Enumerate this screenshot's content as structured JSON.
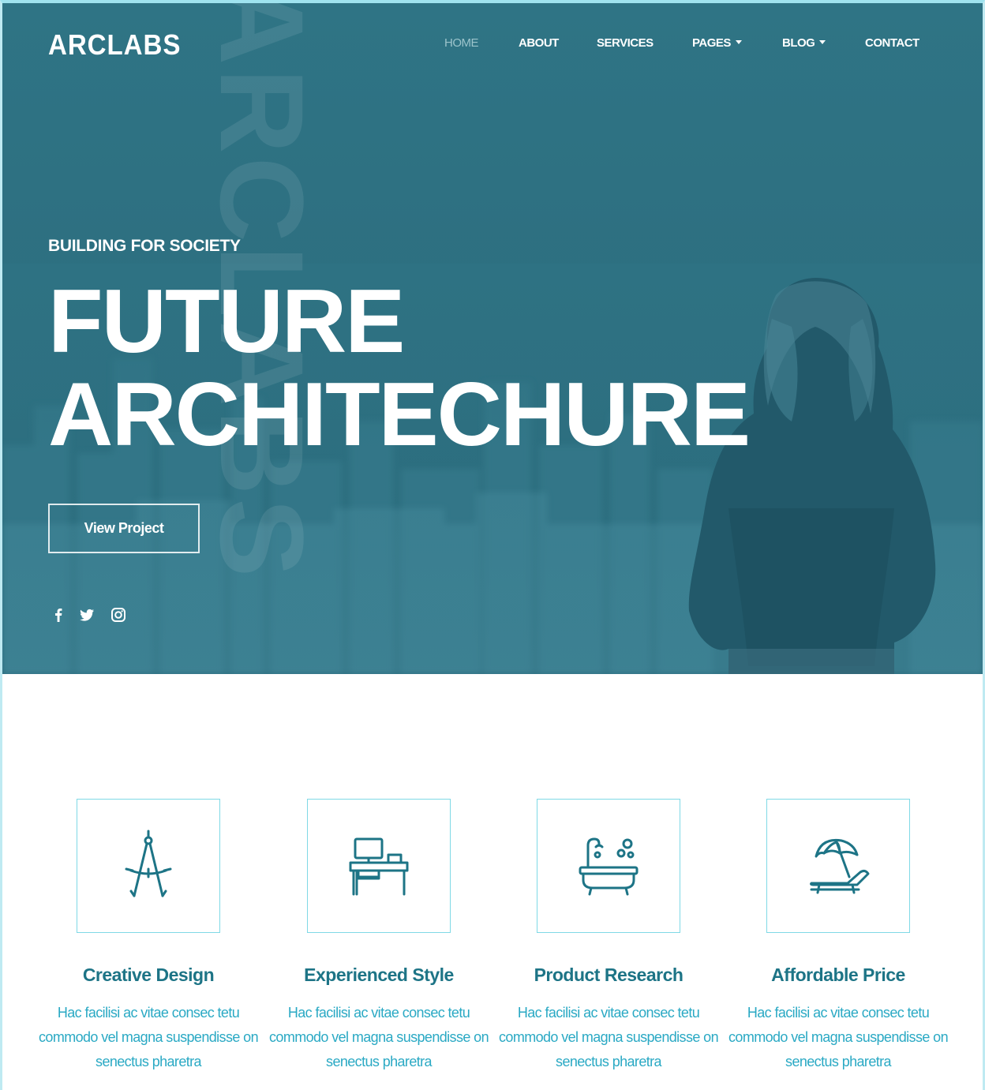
{
  "brand": {
    "logo": "ARCLABS",
    "watermark": "ARCLABS"
  },
  "nav": {
    "items": [
      {
        "label": "HOME",
        "active": true
      },
      {
        "label": "ABOUT"
      },
      {
        "label": "SERVICES"
      },
      {
        "label": "PAGES",
        "dropdown": true
      },
      {
        "label": "BLOG",
        "dropdown": true
      },
      {
        "label": "CONTACT"
      }
    ]
  },
  "hero": {
    "eyebrow": "BUILDING FOR SOCIETY",
    "headline_line1": "FUTURE",
    "headline_line2": "ARCHITECHURE",
    "cta_label": "View Project",
    "social": [
      "facebook-icon",
      "twitter-icon",
      "instagram-icon"
    ],
    "overlay_color": "#2d7081"
  },
  "features": [
    {
      "icon": "compass-icon",
      "title": "Creative Design",
      "text": "Hac facilisi ac vitae consec tetu commodo vel magna suspendisse on senectus pharetra"
    },
    {
      "icon": "desk-computer-icon",
      "title": "Experienced Style",
      "text": "Hac facilisi ac vitae consec tetu commodo vel magna suspendisse on senectus pharetra"
    },
    {
      "icon": "bathtub-icon",
      "title": "Product Research",
      "text": "Hac facilisi ac vitae consec tetu commodo vel magna suspendisse on senectus pharetra"
    },
    {
      "icon": "sunbed-umbrella-icon",
      "title": "Affordable Price",
      "text": "Hac facilisi ac vitae consec tetu commodo vel magna suspendisse on senectus pharetra"
    }
  ],
  "colors": {
    "accent": "#1d7486",
    "body_text": "#2aa9c4",
    "box_border": "#7fd9e6"
  }
}
